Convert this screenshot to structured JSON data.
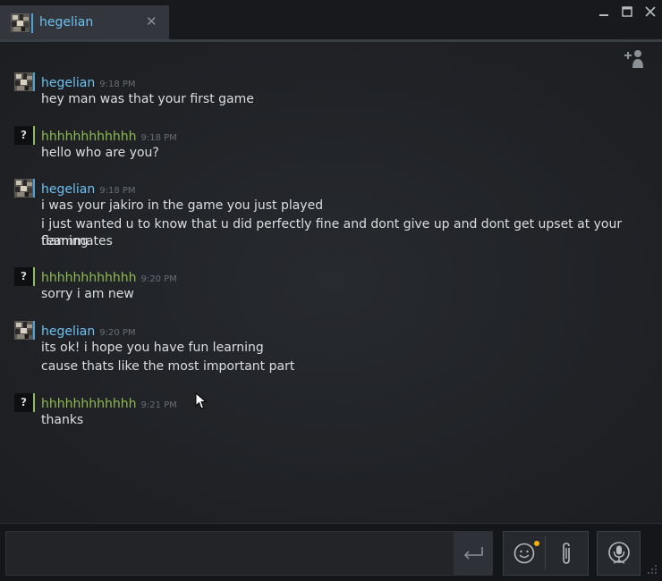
{
  "tab": {
    "title": "hegelian",
    "close_glyph": "✕"
  },
  "window_controls": {
    "minimize": "minimize-icon",
    "maximize": "maximize-icon",
    "close": "close-icon"
  },
  "messages": [
    {
      "sender": "hegelian",
      "time": "9:18 PM",
      "lines": [
        "hey man was that your first game"
      ]
    },
    {
      "sender": "hhhhhhhhhhhh",
      "time": "9:18 PM",
      "lines": [
        "hello who are you?"
      ]
    },
    {
      "sender": "hegelian",
      "time": "9:18 PM",
      "lines": [
        "i was your jakiro in the game you just played",
        "i just wanted u to know that u did perfectly fine and dont give up and dont get upset at your flaming",
        "teammates"
      ]
    },
    {
      "sender": "hhhhhhhhhhhh",
      "time": "9:20 PM",
      "lines": [
        "sorry i am new"
      ]
    },
    {
      "sender": "hegelian",
      "time": "9:20 PM",
      "lines": [
        "its ok! i hope you have fun learning",
        "cause thats like the most important part"
      ]
    },
    {
      "sender": "hhhhhhhhhhhh",
      "time": "9:21 PM",
      "lines": [
        "thanks"
      ]
    }
  ],
  "unknown_avatar": "?",
  "input": {
    "value": "",
    "placeholder": ""
  },
  "colors": {
    "friend_name": "#6dc1f2",
    "other_name": "#8fba52",
    "notification_dot": "#f3b700"
  }
}
